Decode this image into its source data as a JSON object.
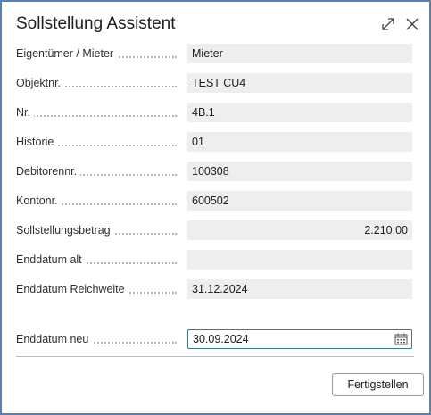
{
  "dialog": {
    "title": "Sollstellung Assistent",
    "expand_icon": "expand-icon",
    "close_icon": "close-icon"
  },
  "fields": [
    {
      "label": "Eigentümer / Mieter",
      "value": "Mieter"
    },
    {
      "label": "Objektnr.",
      "value": "TEST CU4"
    },
    {
      "label": "Nr.",
      "value": "4B.1"
    },
    {
      "label": "Historie",
      "value": "01"
    },
    {
      "label": "Debitorennr.",
      "value": "100308"
    },
    {
      "label": "Kontonr.",
      "value": "600502"
    },
    {
      "label": "Sollstellungsbetrag",
      "value": "2.210,00"
    },
    {
      "label": "Enddatum alt",
      "value": ""
    },
    {
      "label": "Enddatum Reichweite",
      "value": "31.12.2024"
    }
  ],
  "new_end_date": {
    "label": "Enddatum neu",
    "value": "30.09.2024",
    "icon": "calendar-icon"
  },
  "actions": {
    "finish_label": "Fertigstellen"
  },
  "colors": {
    "frame_border": "#5b7fb0",
    "field_background": "#eeeeee",
    "input_border": "#3b7a7e"
  }
}
